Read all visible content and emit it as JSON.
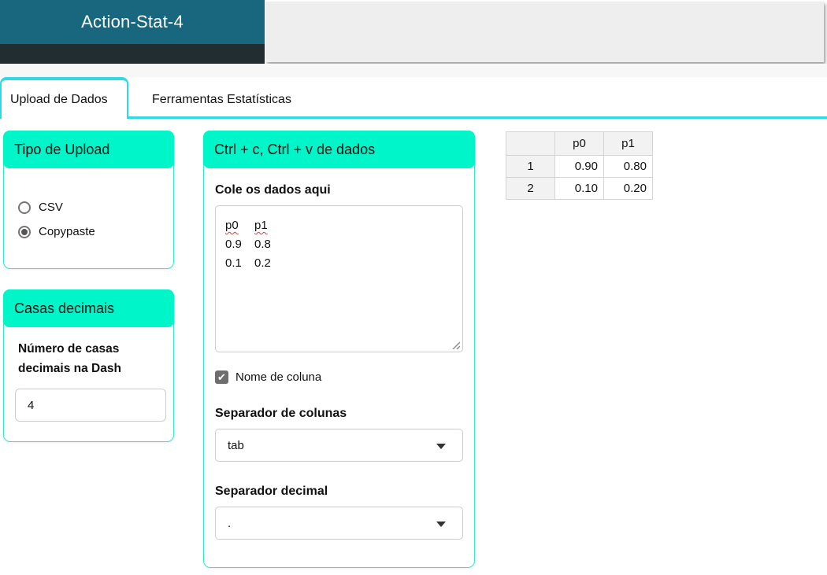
{
  "app": {
    "title": "Action-Stat-4"
  },
  "tabs": {
    "active_label": "Upload de Dados",
    "inactive_label": "Ferramentas Estatísticas"
  },
  "upload_type_panel": {
    "title": "Tipo de Upload",
    "options": [
      {
        "label": "CSV",
        "selected": false
      },
      {
        "label": "Copypaste",
        "selected": true
      }
    ]
  },
  "decimals_panel": {
    "title": "Casas decimais",
    "label": "Número de casas decimais na Dash",
    "value": "4"
  },
  "paste_panel": {
    "title": "Ctrl + c, Ctrl + v de dados",
    "textarea_label": "Cole os dados aqui",
    "textarea_lines": [
      [
        "p0",
        "p1"
      ],
      [
        "0.9",
        "0.8"
      ],
      [
        "0.1",
        "0.2"
      ]
    ],
    "checkbox_label": "Nome de coluna",
    "checkbox_checked": true,
    "col_sep_label": "Separador de colunas",
    "col_sep_value": "tab",
    "dec_sep_label": "Separador decimal",
    "dec_sep_value": "."
  },
  "preview_table": {
    "header": [
      "",
      "p0",
      "p1"
    ],
    "rows": [
      [
        "1",
        "0.90",
        "0.80"
      ],
      [
        "2",
        "0.10",
        "0.20"
      ]
    ]
  },
  "colors": {
    "header_teal": "#19677e",
    "header_dark": "#222d32",
    "panel_header_bg": "#00f5c8",
    "panel_border": "#3ae3cd",
    "tab_accent": "#2fd9e6",
    "gray_window_bg": "#eeeeee"
  }
}
